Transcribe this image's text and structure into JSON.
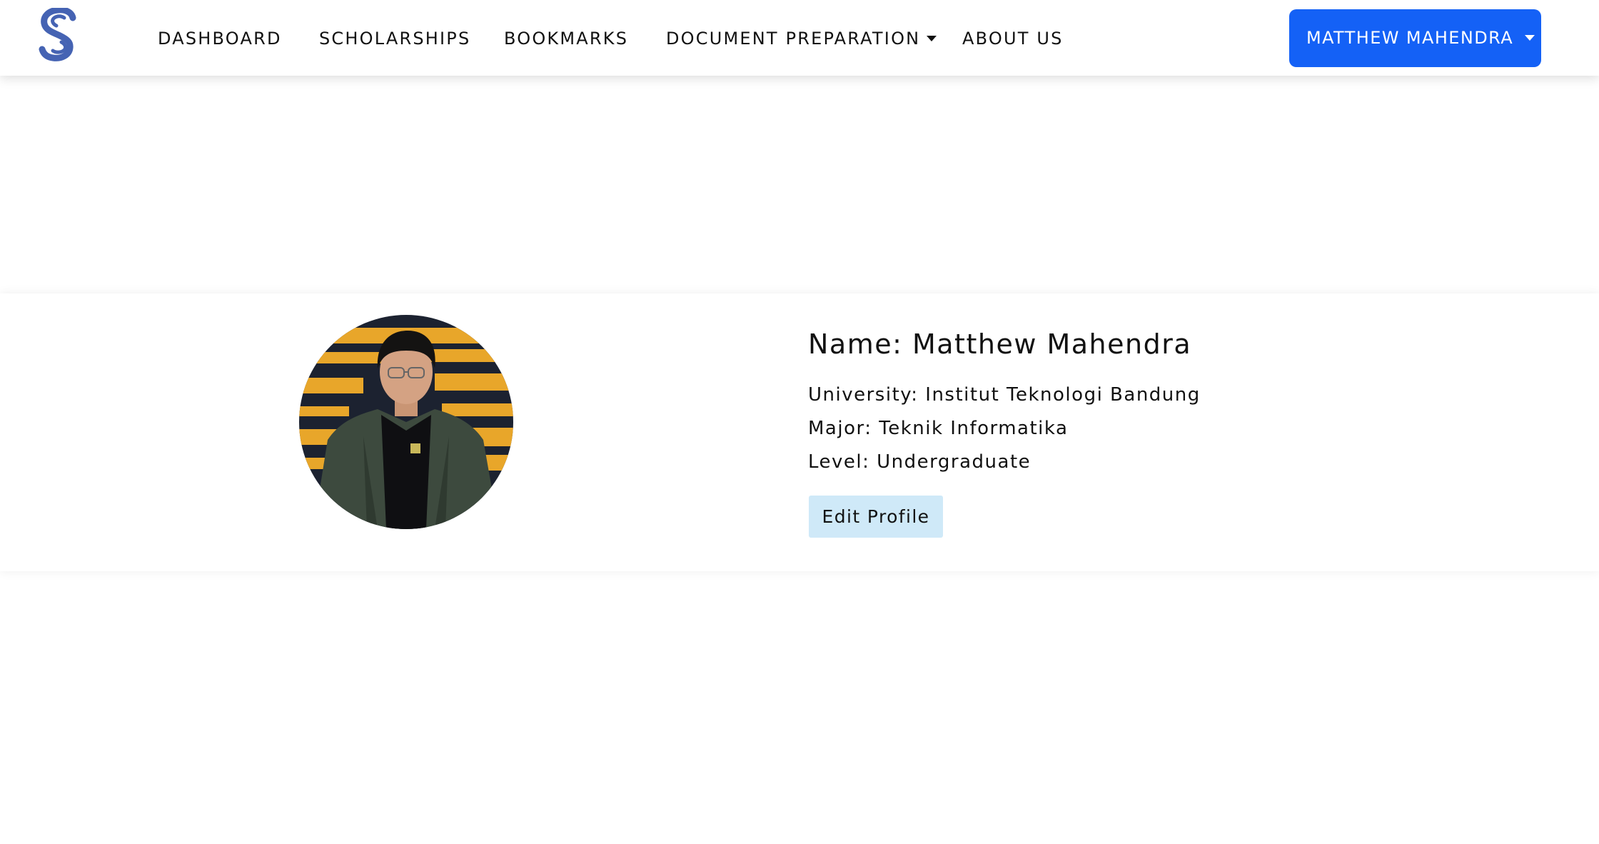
{
  "brand": {
    "logo_icon": "s-logo-icon",
    "logo_color": "#4563b3"
  },
  "nav": {
    "items": [
      {
        "label": "DASHBOARD"
      },
      {
        "label": "SCHOLARSHIPS"
      },
      {
        "label": "BOOKMARKS"
      },
      {
        "label": "DOCUMENT PREPARATION",
        "has_dropdown": true
      },
      {
        "label": "ABOUT US"
      }
    ],
    "user_menu": {
      "label": "MATTHEW MAHENDRA",
      "color": "#1461f6"
    }
  },
  "profile": {
    "name_line": "Name: Matthew Mahendra",
    "university_line": "University: Institut Teknologi Bandung",
    "major_line": "Major: Teknik Informatika",
    "level_line": "Level: Undergraduate",
    "edit_button": "Edit Profile",
    "edit_button_color": "#cfe9f8"
  }
}
